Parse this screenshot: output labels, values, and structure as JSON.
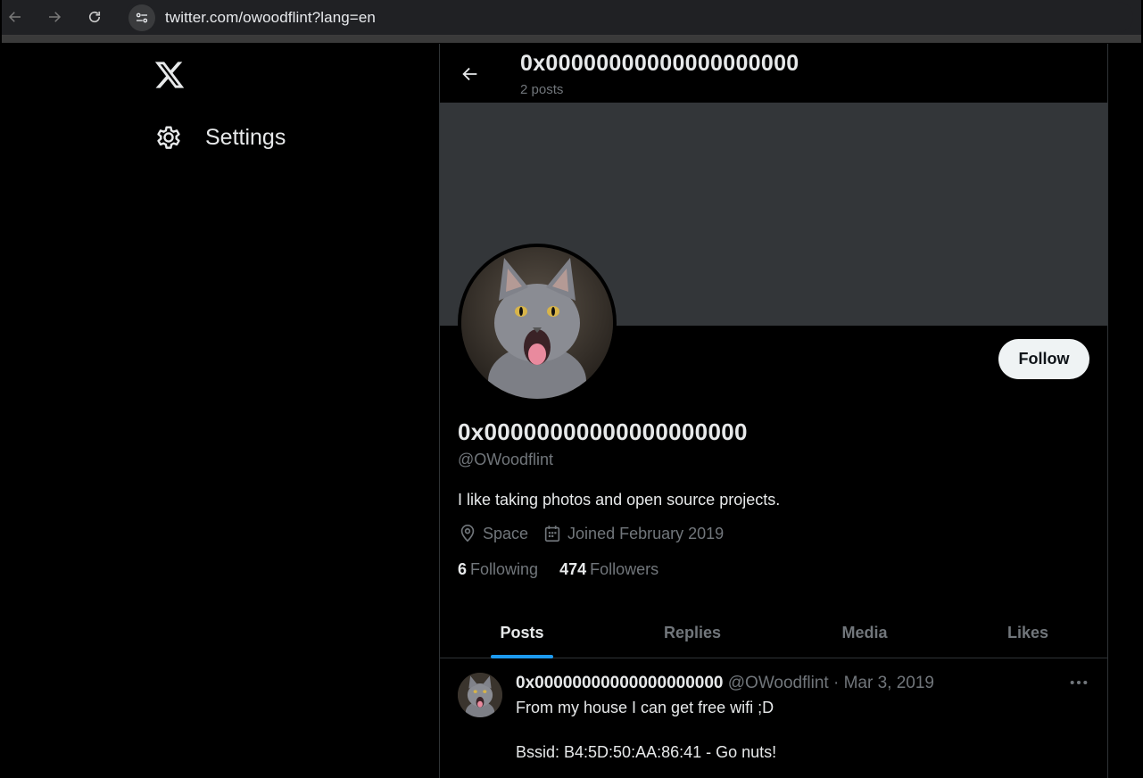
{
  "browser": {
    "url": "twitter.com/owoodflint?lang=en"
  },
  "sidebar": {
    "settings_label": "Settings"
  },
  "header": {
    "name": "0x00000000000000000000",
    "posts_count": "2 posts"
  },
  "profile": {
    "display_name": "0x00000000000000000000",
    "handle": "@OWoodflint",
    "bio": "I like taking photos and open source projects.",
    "location": "Space",
    "joined": "Joined February 2019",
    "following_count": "6",
    "following_label": "Following",
    "followers_count": "474",
    "followers_label": "Followers",
    "follow_button": "Follow"
  },
  "tabs": [
    {
      "label": "Posts",
      "active": true
    },
    {
      "label": "Replies",
      "active": false
    },
    {
      "label": "Media",
      "active": false
    },
    {
      "label": "Likes",
      "active": false
    }
  ],
  "post": {
    "name": "0x00000000000000000000",
    "handle": "@OWoodflint",
    "separator": "·",
    "date": "Mar 3, 2019",
    "line1": "From my house I can get free wifi ;D",
    "line2": "Bssid: B4:5D:50:AA:86:41 - Go nuts!"
  },
  "colors": {
    "accent": "#1d9bf0",
    "banner": "#333639",
    "muted_text": "#71767b"
  }
}
